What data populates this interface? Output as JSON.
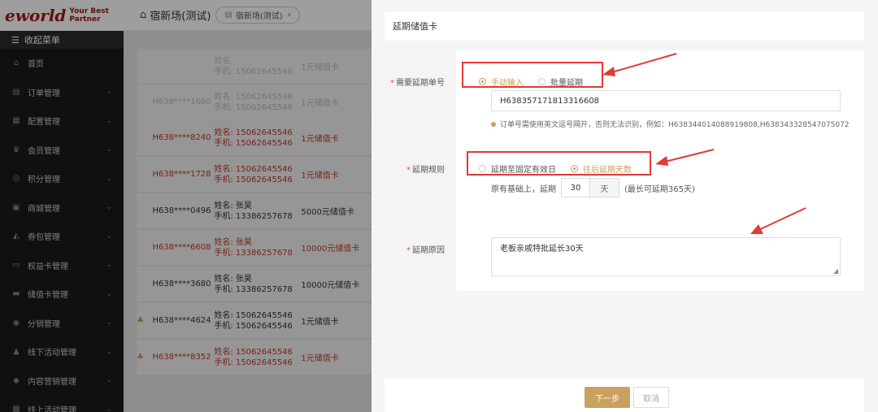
{
  "brand": {
    "logo": "eworld",
    "slogan": "Your Best Partner",
    "color": "#a51717"
  },
  "menu": {
    "head_label": "收起菜单",
    "items": [
      {
        "label": "首页",
        "icon": "home-icon",
        "has_chevron": false
      },
      {
        "label": "订单管理",
        "icon": "order-icon",
        "has_chevron": true
      },
      {
        "label": "配置管理",
        "icon": "config-icon",
        "has_chevron": true
      },
      {
        "label": "会员管理",
        "icon": "crown-icon",
        "has_chevron": true
      },
      {
        "label": "积分管理",
        "icon": "points-icon",
        "has_chevron": true
      },
      {
        "label": "商城管理",
        "icon": "shop-icon",
        "has_chevron": true
      },
      {
        "label": "券包管理",
        "icon": "coupon-icon",
        "has_chevron": true
      },
      {
        "label": "权益卡管理",
        "icon": "card-icon",
        "has_chevron": true
      },
      {
        "label": "储值卡管理",
        "icon": "stored-card-icon",
        "has_chevron": true
      },
      {
        "label": "分销管理",
        "icon": "distribution-icon",
        "has_chevron": true
      },
      {
        "label": "线下活动管理",
        "icon": "offline-activity-icon",
        "has_chevron": true
      },
      {
        "label": "内容营销管理",
        "icon": "content-icon",
        "has_chevron": true
      },
      {
        "label": "线上活动管理",
        "icon": "online-activity-icon",
        "has_chevron": true
      }
    ]
  },
  "topbar": {
    "store_name": "宿新场(测试)",
    "switch_label": "宿新场(测试)"
  },
  "table": {
    "faded_rows": [
      {
        "name": "姓名:",
        "phone": "手机: 15062645546",
        "card": "1元储值卡"
      },
      {
        "id": "H638****1660",
        "name": "姓名: 15062645546",
        "phone": "手机: 15062645546",
        "card": "1元储值卡"
      }
    ],
    "rows": [
      {
        "id": "H638****8240",
        "name": "姓名: 15062645546",
        "phone": "手机: 15062645546",
        "card": "1元储值卡",
        "style": "red",
        "vip": false
      },
      {
        "id": "H638****1728",
        "name": "姓名: 15062645546",
        "phone": "手机: 15062645546",
        "card": "1元储值卡",
        "style": "red",
        "vip": false
      },
      {
        "id": "H638****0496",
        "name": "姓名: 张昊",
        "phone": "手机: 13386257678",
        "card": "5000元储值卡",
        "style": "gray",
        "vip": false
      },
      {
        "id": "H638****6608",
        "name": "姓名: 张昊",
        "phone": "手机: 13386257678",
        "card": "10000元储值卡",
        "style": "red",
        "vip": false
      },
      {
        "id": "H638****3680",
        "name": "姓名: 张昊",
        "phone": "手机: 13386257678",
        "card": "10000元储值卡",
        "style": "gray",
        "vip": false
      },
      {
        "id": "H638****4624",
        "name": "姓名: 15062645546",
        "phone": "手机: 15062645546",
        "card": "1元储值卡",
        "style": "gray",
        "vip": true
      },
      {
        "id": "H638****8352",
        "name": "姓名: 15062645546",
        "phone": "手机: 15062645546",
        "card": "1元储值卡",
        "style": "red",
        "vip": true
      }
    ]
  },
  "drawer": {
    "title": "延期储值卡",
    "fields": {
      "order_label": "需要延期单号",
      "order_mode_options": [
        {
          "label": "手动输入",
          "selected": true
        },
        {
          "label": "批量延期",
          "selected": false
        }
      ],
      "order_value": "H638357171813316608",
      "order_hint": "订单号需使用英文逗号隔开，否则无法识别，例如：H638344014088919808,H638343328547075072",
      "rule_label": "延期规则",
      "rule_options": [
        {
          "label": "延期至固定有效日",
          "selected": false
        },
        {
          "label": "往后延期天数",
          "selected": true
        }
      ],
      "rule_prefix": "原有基础上，延期",
      "rule_days": "30",
      "rule_unit": "天",
      "rule_note": "(最长可延期365天)",
      "reason_label": "延期原因",
      "reason_value": "老板亲戚特批延长30天"
    },
    "buttons": {
      "next": "下一步",
      "cancel": "取消"
    }
  },
  "colors": {
    "accent": "#c9a060",
    "annotation": "#e53935",
    "sidebar_bg": "#1a1a1a"
  }
}
